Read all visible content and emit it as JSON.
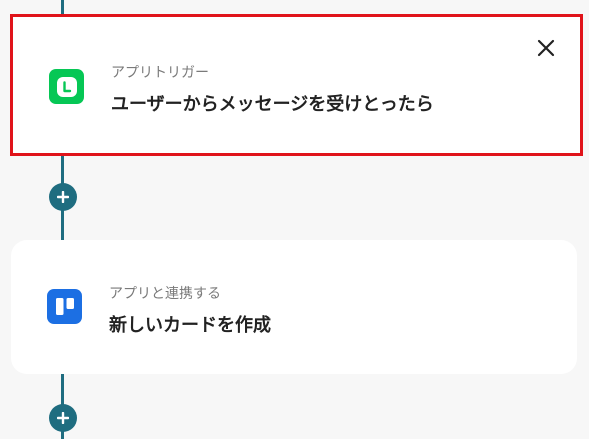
{
  "trigger_card": {
    "subtitle": "アプリトリガー",
    "title": "ユーザーからメッセージを受けとったら",
    "icon": "line-app-icon",
    "selected": true,
    "selected_color": "#e0131a",
    "icon_color": "#06c755"
  },
  "action_card": {
    "subtitle": "アプリと連携する",
    "title": "新しいカードを作成",
    "icon": "trello-app-icon",
    "icon_color": "#1c6fe3"
  },
  "flow": {
    "accent_color": "#1f6d80",
    "add_step_icon": "plus-icon"
  },
  "close_icon": "close-icon"
}
